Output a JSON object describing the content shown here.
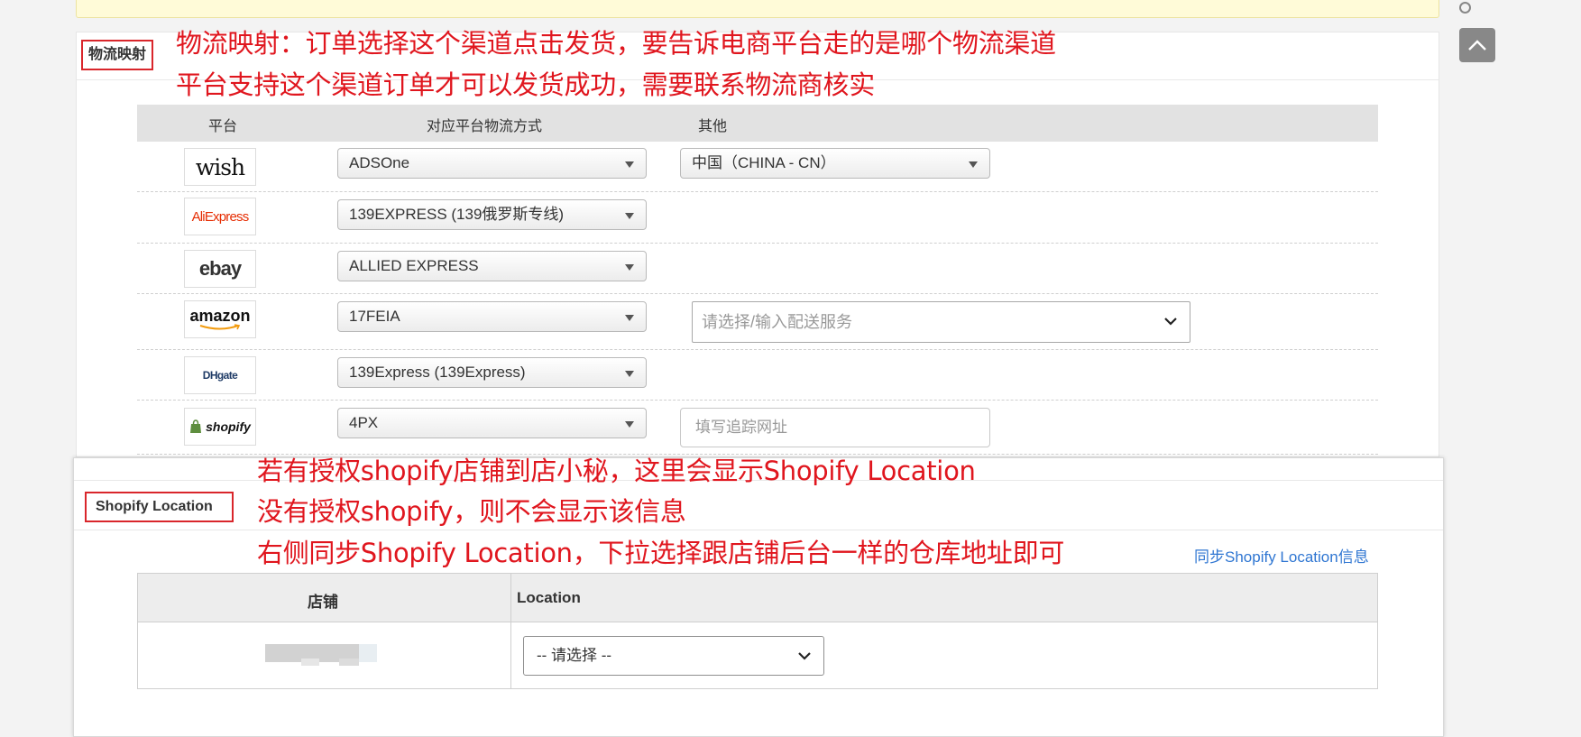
{
  "logistics_mapping": {
    "title": "物流映射",
    "annotation": {
      "line1": "物流映射：订单选择这个渠道点击发货，要告诉电商平台走的是哪个物流渠道",
      "line2": "平台支持这个渠道订单才可以发货成功，需要联系物流商核实"
    },
    "columns": {
      "platform": "平台",
      "method": "对应平台物流方式",
      "other": "其他"
    },
    "rows": [
      {
        "platform": "wish",
        "method": "ADSOne",
        "other_select": "中国（CHINA - CN）"
      },
      {
        "platform": "AliExpress",
        "method": "139EXPRESS (139俄罗斯专线)"
      },
      {
        "platform": "ebay",
        "method": "ALLIED EXPRESS"
      },
      {
        "platform": "amazon",
        "method": "17FEIA",
        "service_placeholder": "请选择/输入配送服务"
      },
      {
        "platform": "DHgate",
        "method": "139Express (139Express)"
      },
      {
        "platform": "shopify",
        "method": "4PX",
        "tracking_placeholder": "填写追踪网址"
      }
    ]
  },
  "shopify_location": {
    "title": "Shopify Location",
    "annotation": {
      "line1": "若有授权shopify店铺到店小秘，这里会显示Shopify Location",
      "line2": "没有授权shopify，则不会显示该信息",
      "line3": "右侧同步Shopify Location，下拉选择跟店铺后台一样的仓库地址即可"
    },
    "sync_link": "同步Shopify Location信息",
    "columns": {
      "store": "店铺",
      "location": "Location"
    },
    "row": {
      "location_select": "-- 请选择 --"
    }
  },
  "colors": {
    "annotation_red": "#e0161e",
    "link_blue": "#2f76d2",
    "header_gray": "#e2e2e2"
  }
}
